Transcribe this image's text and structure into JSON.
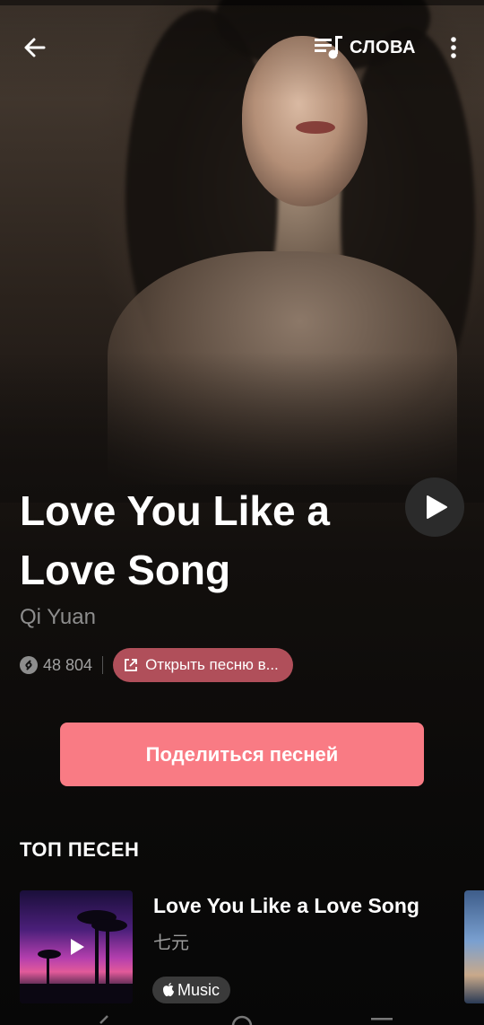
{
  "header": {
    "back_icon": "arrow-left-icon",
    "lyrics_icon": "lyrics-icon",
    "lyrics_label": "СЛОВА",
    "more_icon": "more-vertical-icon"
  },
  "song": {
    "title": "Love You Like a Love Song",
    "artist": "Qi Yuan",
    "shazam_count": "48 804",
    "open_in_label": "Открыть песню в..."
  },
  "actions": {
    "share_label": "Поделиться песней"
  },
  "top_songs": {
    "heading": "ТОП ПЕСЕН",
    "items": [
      {
        "title": "Love You Like a Love Song",
        "artist": "七元",
        "badge_icon": "apple-logo-icon",
        "badge_label": "Music"
      }
    ]
  },
  "colors": {
    "accent": "#f97b84",
    "pill": "#b04f5a",
    "play_button": "#2b2b2b"
  }
}
